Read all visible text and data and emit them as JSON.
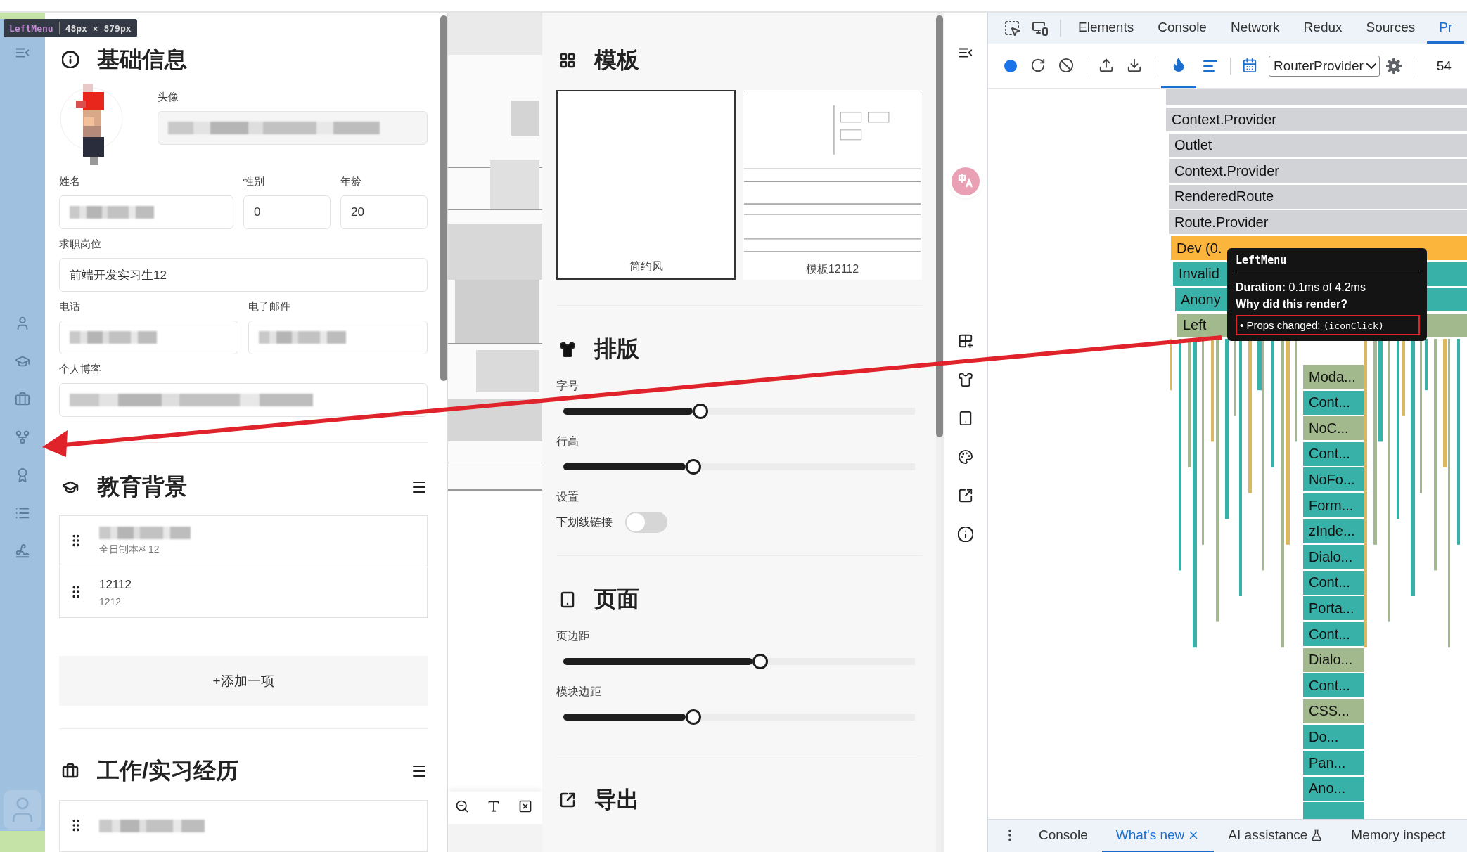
{
  "inspector_badge": {
    "component": "LeftMenu",
    "size": "48px × 879px"
  },
  "basic_info": {
    "title": "基础信息",
    "avatar": {
      "label": "头像",
      "blurred": true
    },
    "field_rows": [
      [
        {
          "label": "姓名",
          "blurred": true
        },
        {
          "label": "性别",
          "value": "0",
          "blurred": false
        },
        {
          "label": "年龄",
          "value": "20",
          "blurred": false
        }
      ],
      [
        {
          "label": "求职岗位",
          "value": "前端开发实习生12",
          "blurred": false
        }
      ],
      [
        {
          "label": "电话",
          "blurred": true
        },
        {
          "label": "电子邮件",
          "blurred": true
        }
      ],
      [
        {
          "label": "个人博客",
          "blurred": true
        }
      ]
    ]
  },
  "education": {
    "title": "教育背景",
    "items": [
      {
        "blurred": true,
        "subtitle": "全日制本科12"
      },
      {
        "title": "12112",
        "blurred": false,
        "subtitle": "1212"
      }
    ],
    "add_button": "+添加一项"
  },
  "work": {
    "title": "工作/实习经历",
    "items": [
      {
        "blurred": true
      }
    ]
  },
  "templates": {
    "title": "模板",
    "items": [
      {
        "name": "简约风",
        "selected": true
      },
      {
        "name": "模板12112",
        "selected": false
      }
    ]
  },
  "typography": {
    "title": "排版",
    "sliders": [
      {
        "label": "字号",
        "level": 0.39
      },
      {
        "label": "行高",
        "level": 0.37
      }
    ],
    "settings_label": "设置",
    "toggle": {
      "label": "下划线链接",
      "on": false
    }
  },
  "page_settings": {
    "title": "页面",
    "sliders": [
      {
        "label": "页边距",
        "level": 0.56
      },
      {
        "label": "模块边距",
        "level": 0.37
      }
    ]
  },
  "export": {
    "title": "导出"
  },
  "devtools": {
    "tabs": [
      {
        "label": "Elements",
        "selected": false
      },
      {
        "label": "Console",
        "selected": false
      },
      {
        "label": "Network",
        "selected": false
      },
      {
        "label": "Redux",
        "selected": false
      },
      {
        "label": "Sources",
        "selected": false
      },
      {
        "label": "Pr",
        "selected": true
      }
    ],
    "root_select": "RouterProvider",
    "commit_count": "54",
    "flame_chart": {
      "wide_rows": [
        {
          "label": "Context.Provider",
          "kind": "gray"
        },
        {
          "label": "Outlet",
          "kind": "gray"
        },
        {
          "label": "Context.Provider",
          "kind": "gray"
        },
        {
          "label": "RenderedRoute",
          "kind": "gray"
        },
        {
          "label": "Route.Provider",
          "kind": "gray"
        },
        {
          "label": "Dev (0.",
          "kind": "orange"
        },
        {
          "label": "Invalid",
          "kind": "teal"
        },
        {
          "label": "Anony",
          "kind": "teal"
        },
        {
          "label": "Left",
          "kind": "olive"
        }
      ],
      "narrow_rows": [
        {
          "label": "Moda...",
          "kind": "olive"
        },
        {
          "label": "Cont...",
          "kind": "teal"
        },
        {
          "label": "NoC...",
          "kind": "olive"
        },
        {
          "label": "Cont...",
          "kind": "teal"
        },
        {
          "label": "NoFo...",
          "kind": "teal"
        },
        {
          "label": "Form...",
          "kind": "teal"
        },
        {
          "label": "zInde...",
          "kind": "teal"
        },
        {
          "label": "Dialo...",
          "kind": "teal"
        },
        {
          "label": "Cont...",
          "kind": "teal"
        },
        {
          "label": "Porta...",
          "kind": "teal"
        },
        {
          "label": "Cont...",
          "kind": "teal"
        },
        {
          "label": "Dialo...",
          "kind": "olive"
        },
        {
          "label": "Cont...",
          "kind": "teal"
        },
        {
          "label": "CSS...",
          "kind": "olive"
        },
        {
          "label": "Do...",
          "kind": "teal"
        },
        {
          "label": "Pan...",
          "kind": "teal"
        },
        {
          "label": "Ano...",
          "kind": "teal"
        }
      ],
      "tooltip": {
        "title": "LeftMenu",
        "duration_label": "Duration:",
        "duration": "0.1ms of 4.2ms",
        "why": "Why did this render?",
        "reason": "• Props changed:",
        "props": "(iconClick)"
      }
    },
    "drawer_tabs": [
      {
        "label": "Console",
        "selected": false,
        "closable": false
      },
      {
        "label": "What's new",
        "selected": true,
        "closable": true
      },
      {
        "label": "AI assistance",
        "selected": false,
        "closable": false
      },
      {
        "label": "Memory inspect",
        "selected": false,
        "closable": false
      }
    ]
  }
}
